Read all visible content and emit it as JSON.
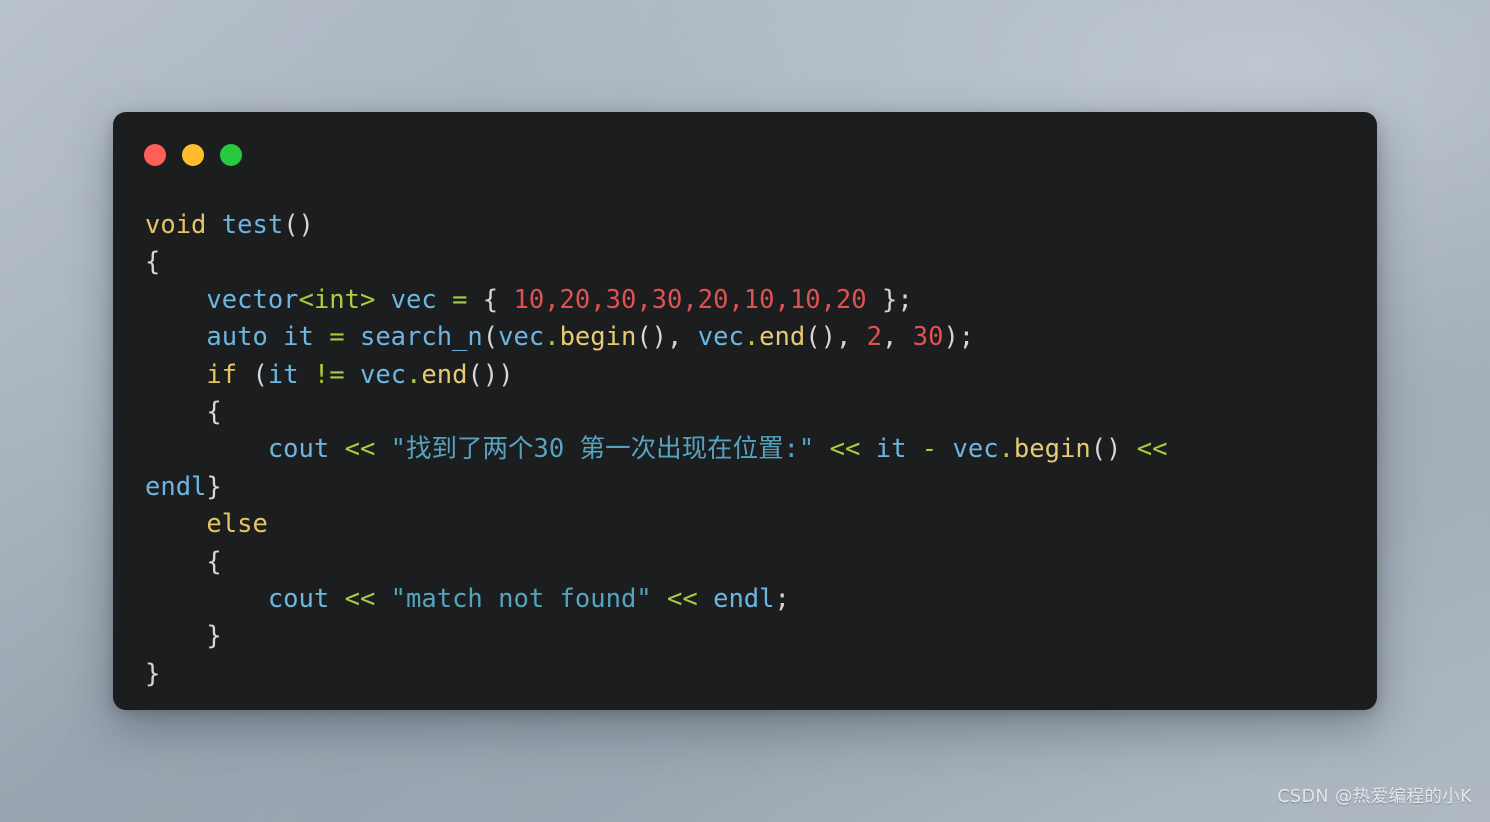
{
  "window": {
    "title_bar": {
      "buttons": [
        {
          "name": "close-button",
          "label": "Close",
          "color": "#ff5f56"
        },
        {
          "name": "minimize-button",
          "label": "Minimize",
          "color": "#ffbd2e"
        },
        {
          "name": "maximize-button",
          "label": "Maximize",
          "color": "#27c93f"
        }
      ]
    },
    "background_color": "#1b1d1f"
  },
  "code": {
    "language": "C++",
    "theme_colors": {
      "keyword": "#e6c464",
      "identifier": "#6cb6e0",
      "operator": "#a6cf3f",
      "member": "#e7cb72",
      "number": "#e05252",
      "string": "#56a3bf",
      "punctuation": "#d6d6d6"
    },
    "lines": {
      "l1_void": "void",
      "l1_test": "test",
      "l1_parens": "()",
      "l2_brace": "{",
      "l3_indent": "    ",
      "l3_vector": "vector",
      "l3_int": "<int>",
      "l3_vec": " vec ",
      "l3_eq": "=",
      "l3_open": " { ",
      "l3_nums": "10,20,30,30,20,10,10,20",
      "l3_close": " };",
      "l4_indent": "    ",
      "l4_auto": "auto it ",
      "l4_eq": "=",
      "l4_call": " search_n",
      "l4_p1": "(",
      "l4_vec1": "vec",
      "l4_dot1": ".",
      "l4_begin": "begin",
      "l4_p2": "(), ",
      "l4_vec2": "vec",
      "l4_dot2": ".",
      "l4_end": "end",
      "l4_p3": "(), ",
      "l4_n2": "2",
      "l4_comma": ", ",
      "l4_n30": "30",
      "l4_p4": ");",
      "l5_indent": "    ",
      "l5_if": "if",
      "l5_p1": " (",
      "l5_it": "it ",
      "l5_neq": "!=",
      "l5_vec": " vec",
      "l5_dot": ".",
      "l5_end": "end",
      "l5_p2": "())",
      "l6_brace": "    {",
      "l7_indent": "        ",
      "l7_cout": "cout ",
      "l7_shift1": "<<",
      "l7_str": " \"找到了两个30 第一次出现在位置:\" ",
      "l7_shift2": "<<",
      "l7_it": " it ",
      "l7_minus": "-",
      "l7_vec": " vec",
      "l7_dot": ".",
      "l7_begin": "begin",
      "l7_p": "() ",
      "l7_shift3": "<<",
      "l8_endl": "endl",
      "l8_brace": "}",
      "l9_else": "    else",
      "l10_brace": "    {",
      "l11_indent": "        ",
      "l11_cout": "cout ",
      "l11_shift1": "<<",
      "l11_str": " \"match not found\" ",
      "l11_shift2": "<<",
      "l11_endl": " endl",
      "l11_semi": ";",
      "l12_brace": "    }",
      "l13_brace": "}"
    }
  },
  "watermark": {
    "text": "CSDN @热爱编程的小K"
  }
}
